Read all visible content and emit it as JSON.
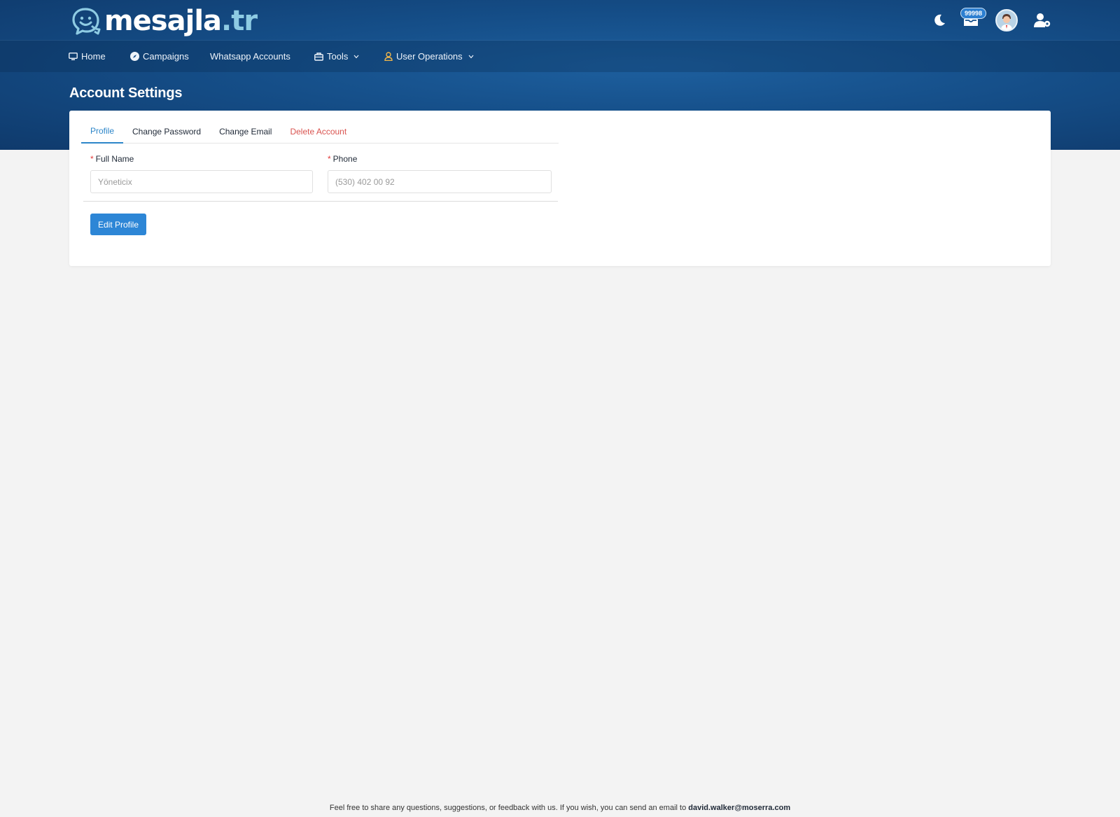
{
  "brand": {
    "name": "mesajla",
    "tld": ".tr"
  },
  "topbar": {
    "notification_count": "99998",
    "icons": [
      "moon-icon",
      "inbox-icon",
      "avatar",
      "user-settings-icon"
    ]
  },
  "nav": {
    "items": [
      {
        "label": "Home",
        "icon": "monitor-icon"
      },
      {
        "label": "Campaigns",
        "icon": "compass-icon"
      },
      {
        "label": "Whatsapp Accounts"
      },
      {
        "label": "Tools",
        "icon": "toolbox-icon",
        "dropdown": true
      },
      {
        "label": "User Operations",
        "icon": "user-icon",
        "dropdown": true
      }
    ]
  },
  "page": {
    "title": "Account Settings"
  },
  "tabs": [
    {
      "label": "Profile",
      "active": true
    },
    {
      "label": "Change Password"
    },
    {
      "label": "Change Email"
    },
    {
      "label": "Delete Account",
      "danger": true
    }
  ],
  "form": {
    "full_name": {
      "label": "Full Name",
      "required": "*",
      "placeholder": "Yöneticix"
    },
    "phone": {
      "label": "Phone",
      "required": "*",
      "placeholder": "(530) 402 00 92"
    },
    "submit_label": "Edit Profile"
  },
  "footer": {
    "text": "Feel free to share any questions, suggestions, or feedback with us. If you wish, you can send an email to ",
    "email": "david.walker@moserra.com"
  },
  "colors": {
    "header_dark": "#0f3a6c",
    "header_mid": "#1d5f9e",
    "accent": "#2d86d6",
    "danger": "#d9534f",
    "background": "#f3f3f3"
  }
}
